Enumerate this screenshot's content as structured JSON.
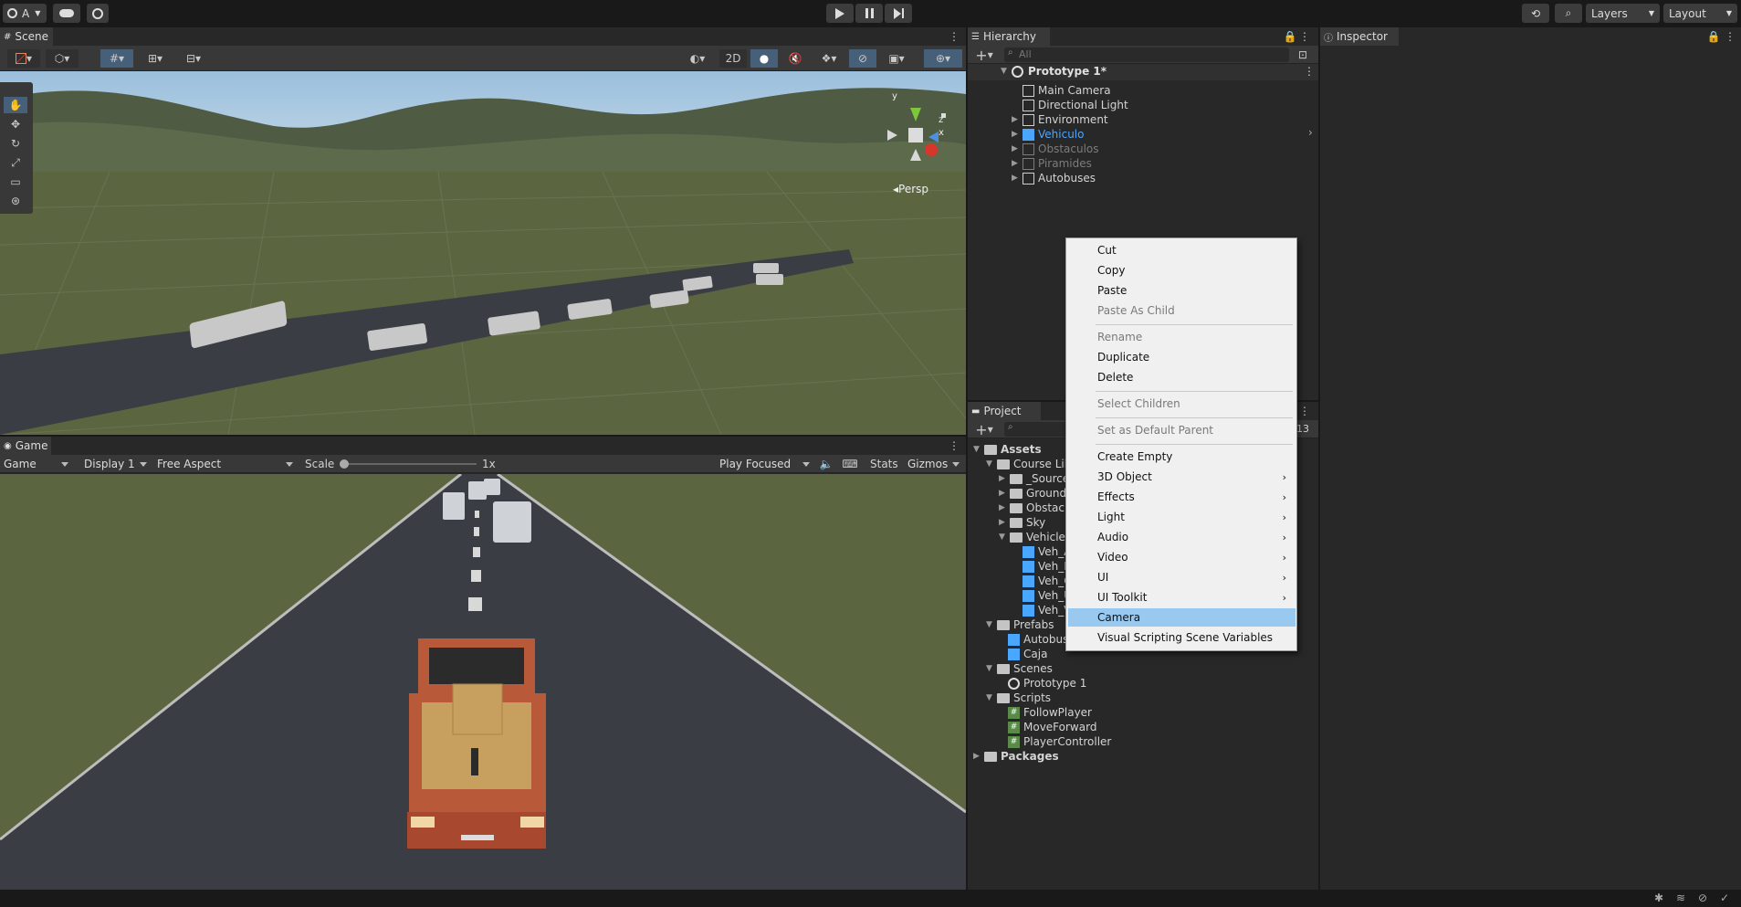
{
  "toolbar": {
    "account": "A",
    "layers": "Layers",
    "layout": "Layout"
  },
  "scene": {
    "tab": "Scene",
    "btn_2d": "2D",
    "persp": "Persp",
    "axis_y": "y",
    "axis_z": "z",
    "axis_x": "x"
  },
  "game": {
    "tab": "Game",
    "mode": "Game",
    "display": "Display 1",
    "aspect": "Free Aspect",
    "scale_label": "Scale",
    "scale_value": "1x",
    "play_focused": "Play Focused",
    "stats": "Stats",
    "gizmos": "Gizmos"
  },
  "hierarchy": {
    "tab": "Hierarchy",
    "search_placeholder": "All",
    "scene_name": "Prototype 1*",
    "items": [
      "Main Camera",
      "Directional Light",
      "Environment",
      "Vehiculo",
      "Obstaculos",
      "Piramides",
      "Autobuses"
    ]
  },
  "project": {
    "tab": "Project",
    "count": "13",
    "assets": "Assets",
    "course": "Course Lib",
    "source": "_Source",
    "ground": "Ground",
    "obstacles": "Obstacle",
    "sky": "Sky",
    "vehicles": "Vehicles",
    "veh": [
      "Veh_A",
      "Veh_B",
      "Veh_C",
      "Veh_U",
      "Veh_V"
    ],
    "prefabs": "Prefabs",
    "prefab_items": [
      "Autobus",
      "Caja"
    ],
    "scenes": "Scenes",
    "scene_item": "Prototype 1",
    "scripts": "Scripts",
    "script_items": [
      "FollowPlayer",
      "MoveForward",
      "PlayerController"
    ],
    "packages": "Packages"
  },
  "inspector": {
    "tab": "Inspector"
  },
  "context_menu": {
    "items": [
      "Cut",
      "Copy",
      "Paste",
      "Paste As Child",
      "Rename",
      "Duplicate",
      "Delete",
      "Select Children",
      "Set as Default Parent",
      "Create Empty",
      "3D Object",
      "Effects",
      "Light",
      "Audio",
      "Video",
      "UI",
      "UI Toolkit",
      "Camera",
      "Visual Scripting Scene Variables"
    ]
  },
  "colors": {
    "selected_blue": "#4aa7ff",
    "menu_highlight": "#99c9ef",
    "ground": "#5b6640",
    "road": "#3a3d43"
  }
}
